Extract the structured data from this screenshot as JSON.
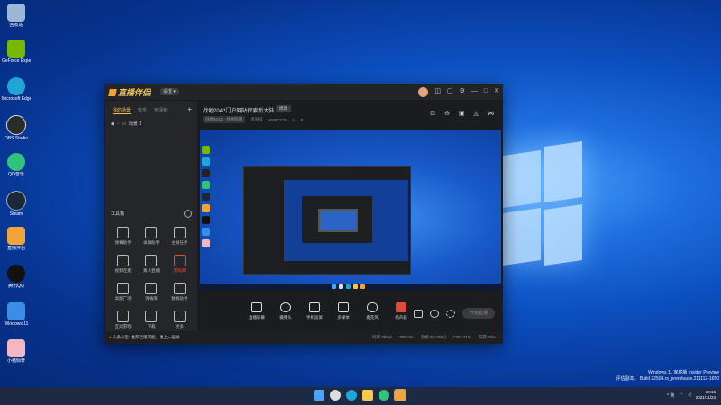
{
  "desktop": {
    "icons": [
      {
        "label": "回收站",
        "color": "#9bb8d8",
        "icon": "recycle-bin-icon"
      },
      {
        "label": "GeForce Experience",
        "color": "#76b900",
        "icon": "nvidia-icon"
      },
      {
        "label": "Microsoft Edge",
        "color": "#1fa6d6",
        "icon": "edge-icon"
      },
      {
        "label": "OBS Studio",
        "color": "#2b2b2b",
        "icon": "obs-icon"
      },
      {
        "label": "QQ音乐",
        "color": "#31c27c",
        "icon": "qqmusic-icon"
      },
      {
        "label": "Steam",
        "color": "#1b2838",
        "icon": "steam-icon"
      },
      {
        "label": "直播伴侣",
        "color": "#f0a43a",
        "icon": "live-companion-icon"
      },
      {
        "label": "腾讯QQ",
        "color": "#111111",
        "icon": "qq-icon"
      },
      {
        "label": "Windows 11",
        "color": "#3a8ee6",
        "icon": "windows-icon"
      },
      {
        "label": "小猪佩奇",
        "color": "#f4b6c2",
        "icon": "pig-icon"
      }
    ],
    "watermark": {
      "line1": "Windows 11 家庭版 Insider Preview",
      "line2": "评估副本。 Build 22504.rs_prerelease.211112-1650"
    }
  },
  "window": {
    "app_name": "直播伴侣",
    "app_badge": "设置 ▾",
    "left_tabs": [
      "我的场景",
      "音乐",
      "可视化"
    ],
    "add_label": "+",
    "scene_item": "场景 1",
    "tools_header": "工具箱",
    "tools": [
      {
        "label": "弹幕助手",
        "highlight": false
      },
      {
        "label": "录屏助手",
        "highlight": false
      },
      {
        "label": "主播任务",
        "highlight": false
      },
      {
        "label": "视频连麦",
        "highlight": false
      },
      {
        "label": "素人直播",
        "highlight": false
      },
      {
        "label": "游戏库",
        "highlight": true
      },
      {
        "label": "高能广场",
        "highlight": false
      },
      {
        "label": "弹幕库",
        "highlight": false
      },
      {
        "label": "数据助手",
        "highlight": false
      },
      {
        "label": "互动游戏",
        "highlight": false
      },
      {
        "label": "下载",
        "highlight": false
      },
      {
        "label": "更多",
        "highlight": false
      }
    ],
    "main": {
      "title": "战地2042门户网站探索新大陆",
      "edit_button": "修改",
      "category": "战地2042 · 战地风暴",
      "room_label": "房间号",
      "room_id": "50287122",
      "fans": "0",
      "top_icons": [
        "gift-icon",
        "lock-icon",
        "layers-icon",
        "bell-icon",
        "share-icon"
      ]
    },
    "bottom_tools": [
      {
        "label": "直播屏幕",
        "icon": "screen-icon"
      },
      {
        "label": "摄像头",
        "icon": "camera-icon"
      },
      {
        "label": "手机投屏",
        "icon": "phone-icon"
      },
      {
        "label": "多媒体",
        "icon": "media-icon"
      },
      {
        "label": "麦克风",
        "icon": "mic-icon"
      },
      {
        "label": "扬声器",
        "icon": "speaker-icon"
      }
    ],
    "go_live": "开始直播",
    "status": {
      "warning_icon": "●",
      "warning_text": "头条公告: 推荐无限可能，更上一层楼",
      "stats": [
        "码率:0kbps",
        "FPS:60",
        "丢帧:0(0.00%)",
        "CPU:21%",
        "内存:15%"
      ]
    }
  },
  "taskbar": {
    "apps": [
      {
        "icon": "start-icon",
        "color": "#4aa3ff"
      },
      {
        "icon": "search-icon",
        "color": "#dddddd"
      },
      {
        "icon": "edge-icon",
        "color": "#1fa6d6"
      },
      {
        "icon": "folder-icon",
        "color": "#f3c84c"
      },
      {
        "icon": "qqmusic-icon",
        "color": "#31c27c"
      },
      {
        "icon": "live-companion-icon",
        "color": "#f0a43a"
      }
    ],
    "tray_text": "^ 英",
    "time": "18:16",
    "date": "2021/11/24"
  }
}
